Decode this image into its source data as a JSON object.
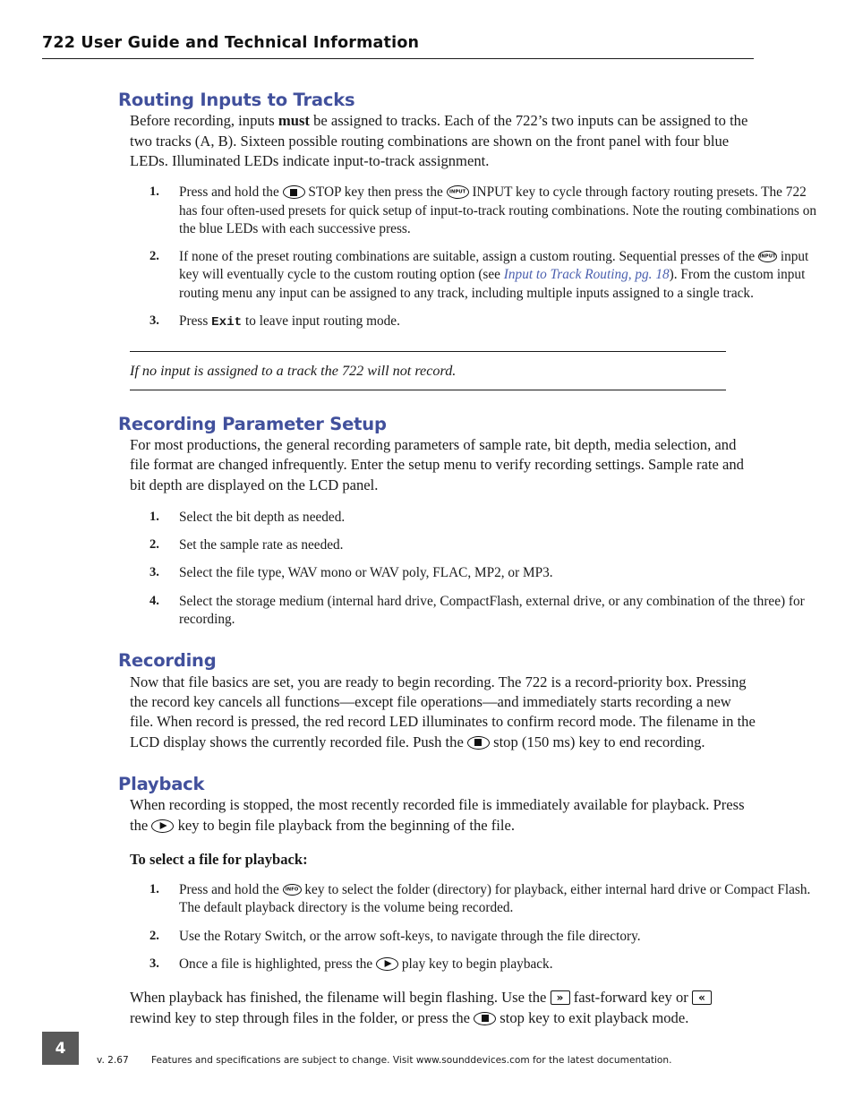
{
  "header": {
    "title": "722 User Guide and Technical Information"
  },
  "sections": {
    "routing": {
      "heading": "Routing Inputs to Tracks",
      "intro_a": "Before recording, inputs ",
      "intro_bold": "must",
      "intro_b": " be assigned to tracks. Each of the 722’s two inputs can be assigned to the two tracks (A, B). Sixteen possible routing combinations are shown on the front panel with four blue LEDs. Illuminated LEDs indicate input-to-track assignment.",
      "steps": [
        {
          "num": "1.",
          "part_a": "Press and hold the ",
          "icon_1": "stop-key-icon",
          "part_b": " STOP key then press the ",
          "icon_2": "input-key-icon",
          "icon_2_label": "INPUT",
          "part_c": " INPUT key to cycle through factory routing presets. The 722 has four often-used presets for quick setup of input-to-track routing combinations. Note the routing combinations on the blue LEDs with each successive press."
        },
        {
          "num": "2.",
          "part_a": "If none of the preset routing combinations are suitable, assign a custom routing. Sequential presses of the ",
          "icon_1": "input-key-icon",
          "icon_1_label": "INPUT",
          "part_b": " input key will eventually cycle to the custom routing option (see ",
          "xref": "Input to Track Routing, pg. 18",
          "part_c": "). From the custom input routing menu any input can be assigned to any track, including multiple inputs assigned to a single track."
        },
        {
          "num": "3.",
          "part_a": "Press ",
          "mono": "Exit",
          "part_b": " to leave input routing mode."
        }
      ],
      "note": "If no input is assigned to a track the 722 will not record."
    },
    "recording_setup": {
      "heading": "Recording Parameter Setup",
      "intro": "For most productions, the general recording parameters of sample rate, bit depth, media selection, and file format are changed infrequently. Enter the setup menu to verify recording settings. Sample rate and bit depth are displayed on the LCD panel.",
      "steps": [
        {
          "num": "1.",
          "text": "Select the bit depth as needed."
        },
        {
          "num": "2.",
          "text": "Set the sample rate as needed."
        },
        {
          "num": "3.",
          "text": "Select the file type, WAV mono or WAV poly, FLAC, MP2, or MP3."
        },
        {
          "num": "4.",
          "text": "Select the storage medium (internal hard drive, CompactFlash, external drive, or any combination of the three) for recording."
        }
      ]
    },
    "recording": {
      "heading": "Recording",
      "part_a": "Now that file basics are set, you are ready to begin recording. The 722 is a record-priority box. Pressing the record key cancels all functions—except file operations—and immediately starts recording a new file. When record is pressed, the red record LED illuminates to confirm record mode. The filename in the LCD display shows the currently recorded file. Push the ",
      "icon_1": "stop-key-icon",
      "part_b": " stop (150 ms) key to end recording."
    },
    "playback": {
      "heading": "Playback",
      "intro_a": "When recording is stopped, the most recently recorded file is immediately available for playback. Press the ",
      "icon_1": "play-key-icon",
      "intro_b": " key to begin file playback from the beginning of the file.",
      "subhead": "To select a file for playback:",
      "steps": [
        {
          "num": "1.",
          "part_a": "Press and hold the ",
          "icon_1": "info-key-icon",
          "icon_1_label": "INFO",
          "part_b": " key to select the folder (directory) for playback, either internal hard drive or Compact Flash. The default playback directory is the volume being recorded."
        },
        {
          "num": "2.",
          "part_a": "Use the Rotary Switch, or the arrow soft-keys, to navigate through the file directory."
        },
        {
          "num": "3.",
          "part_a": "Once a file is highlighted, press the ",
          "icon_1": "play-key-icon",
          "part_b": " play key to begin playback."
        }
      ],
      "closing_a": "When playback has finished, the filename will begin flashing. Use the ",
      "icon_ff": "fast-forward-key-icon",
      "icon_ff_glyph": "»",
      "closing_b": " fast-forward key or ",
      "icon_rew": "rewind-key-icon",
      "icon_rew_glyph": "«",
      "closing_c": " rewind key to step through files in the folder, or press the ",
      "icon_stop": "stop-key-icon",
      "closing_d": " stop key to exit playback mode."
    }
  },
  "footer": {
    "page_number": "4",
    "version": "v. 2.67",
    "note": "Features and specifications are subject to change. Visit www.sounddevices.com for the latest documentation."
  },
  "colors": {
    "heading": "#41509c",
    "xref": "#4a5fae",
    "page_box": "#595959"
  }
}
